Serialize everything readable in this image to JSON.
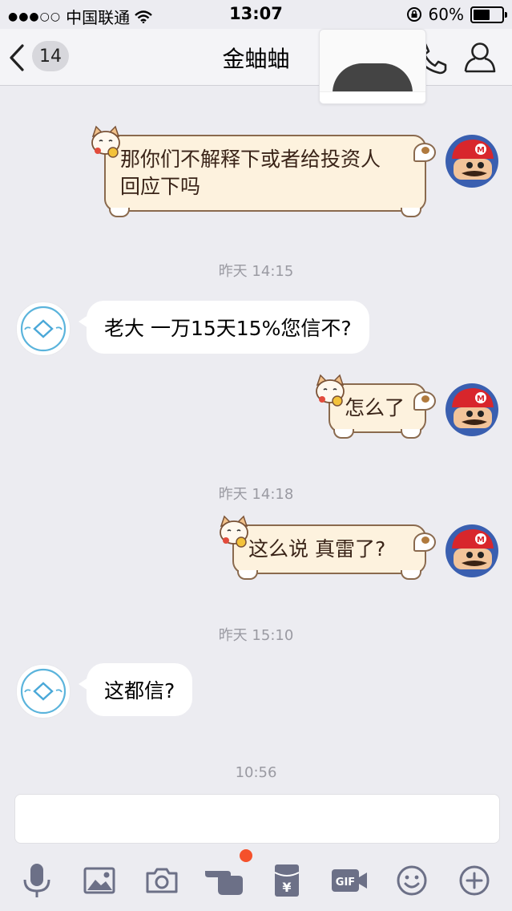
{
  "status_bar": {
    "signal": "●●●○○",
    "carrier": "中国联通",
    "time": "13:07",
    "battery_percent": "60%",
    "battery_level": 0.6
  },
  "nav": {
    "unread_count": "14",
    "title": "金蚰蚰"
  },
  "messages": [
    {
      "side": "right",
      "style": "cat",
      "lines": [
        "那你们不解释下或者给投资人",
        "回应下吗"
      ]
    },
    {
      "time": "昨天 14:15"
    },
    {
      "side": "left",
      "text": "老大 一万15天15%您信不?"
    },
    {
      "side": "right",
      "style": "cat",
      "text": "怎么了"
    },
    {
      "time": "昨天 14:18"
    },
    {
      "side": "right",
      "style": "cat",
      "text": "这么说 真雷了?"
    },
    {
      "time": "昨天 15:10"
    },
    {
      "side": "left",
      "text": "这都信?"
    },
    {
      "time": "10:56"
    }
  ],
  "toolbar": {
    "icons": [
      "microphone-icon",
      "image-icon",
      "camera-icon",
      "poke-icon",
      "red-packet-icon",
      "gif-icon",
      "emoji-icon",
      "plus-icon"
    ],
    "red_packet_glyph": "¥",
    "gif_label": "GIF"
  },
  "colors": {
    "background": "#ececf1",
    "cat_bubble_fill": "#fdf2de",
    "cat_bubble_border": "#8a6a4e",
    "badge": "#d7d7dc",
    "notification_dot": "#f5512b",
    "toolbar_icon": "#6c7087"
  }
}
